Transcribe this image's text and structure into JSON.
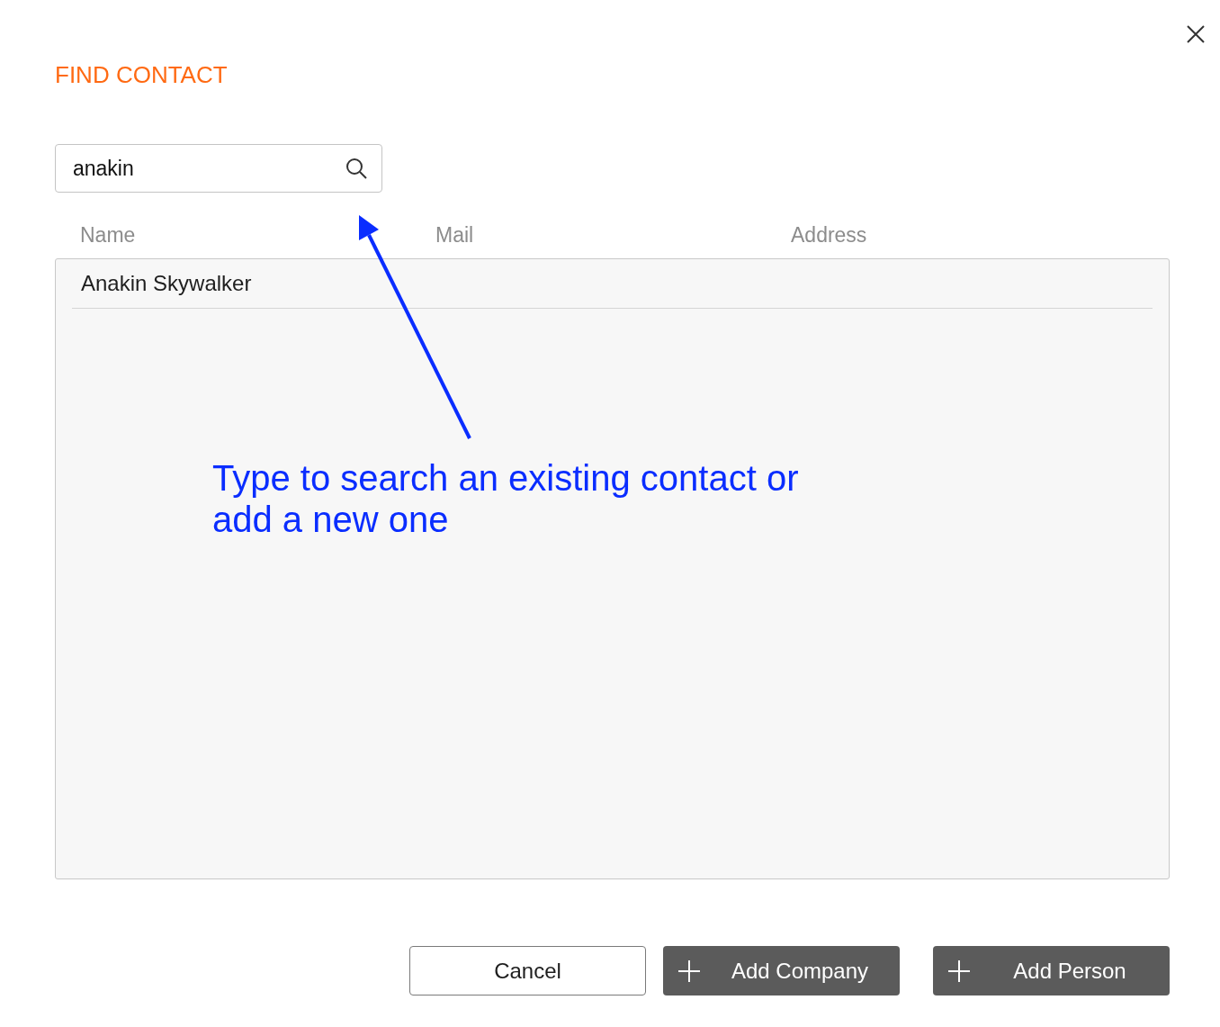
{
  "dialog": {
    "title": "FIND CONTACT"
  },
  "search": {
    "value": "anakin"
  },
  "table": {
    "columns": [
      "Name",
      "Mail",
      "Address"
    ],
    "rows": [
      {
        "cells": [
          "Anakin Skywalker"
        ]
      }
    ]
  },
  "annotation": {
    "text": "Type to search an existing contact or add a new one"
  },
  "buttons": [
    {
      "kind": "outline",
      "label": "Cancel"
    },
    {
      "kind": "add",
      "label": "Add Company"
    },
    {
      "kind": "add",
      "label": "Add Person"
    }
  ]
}
